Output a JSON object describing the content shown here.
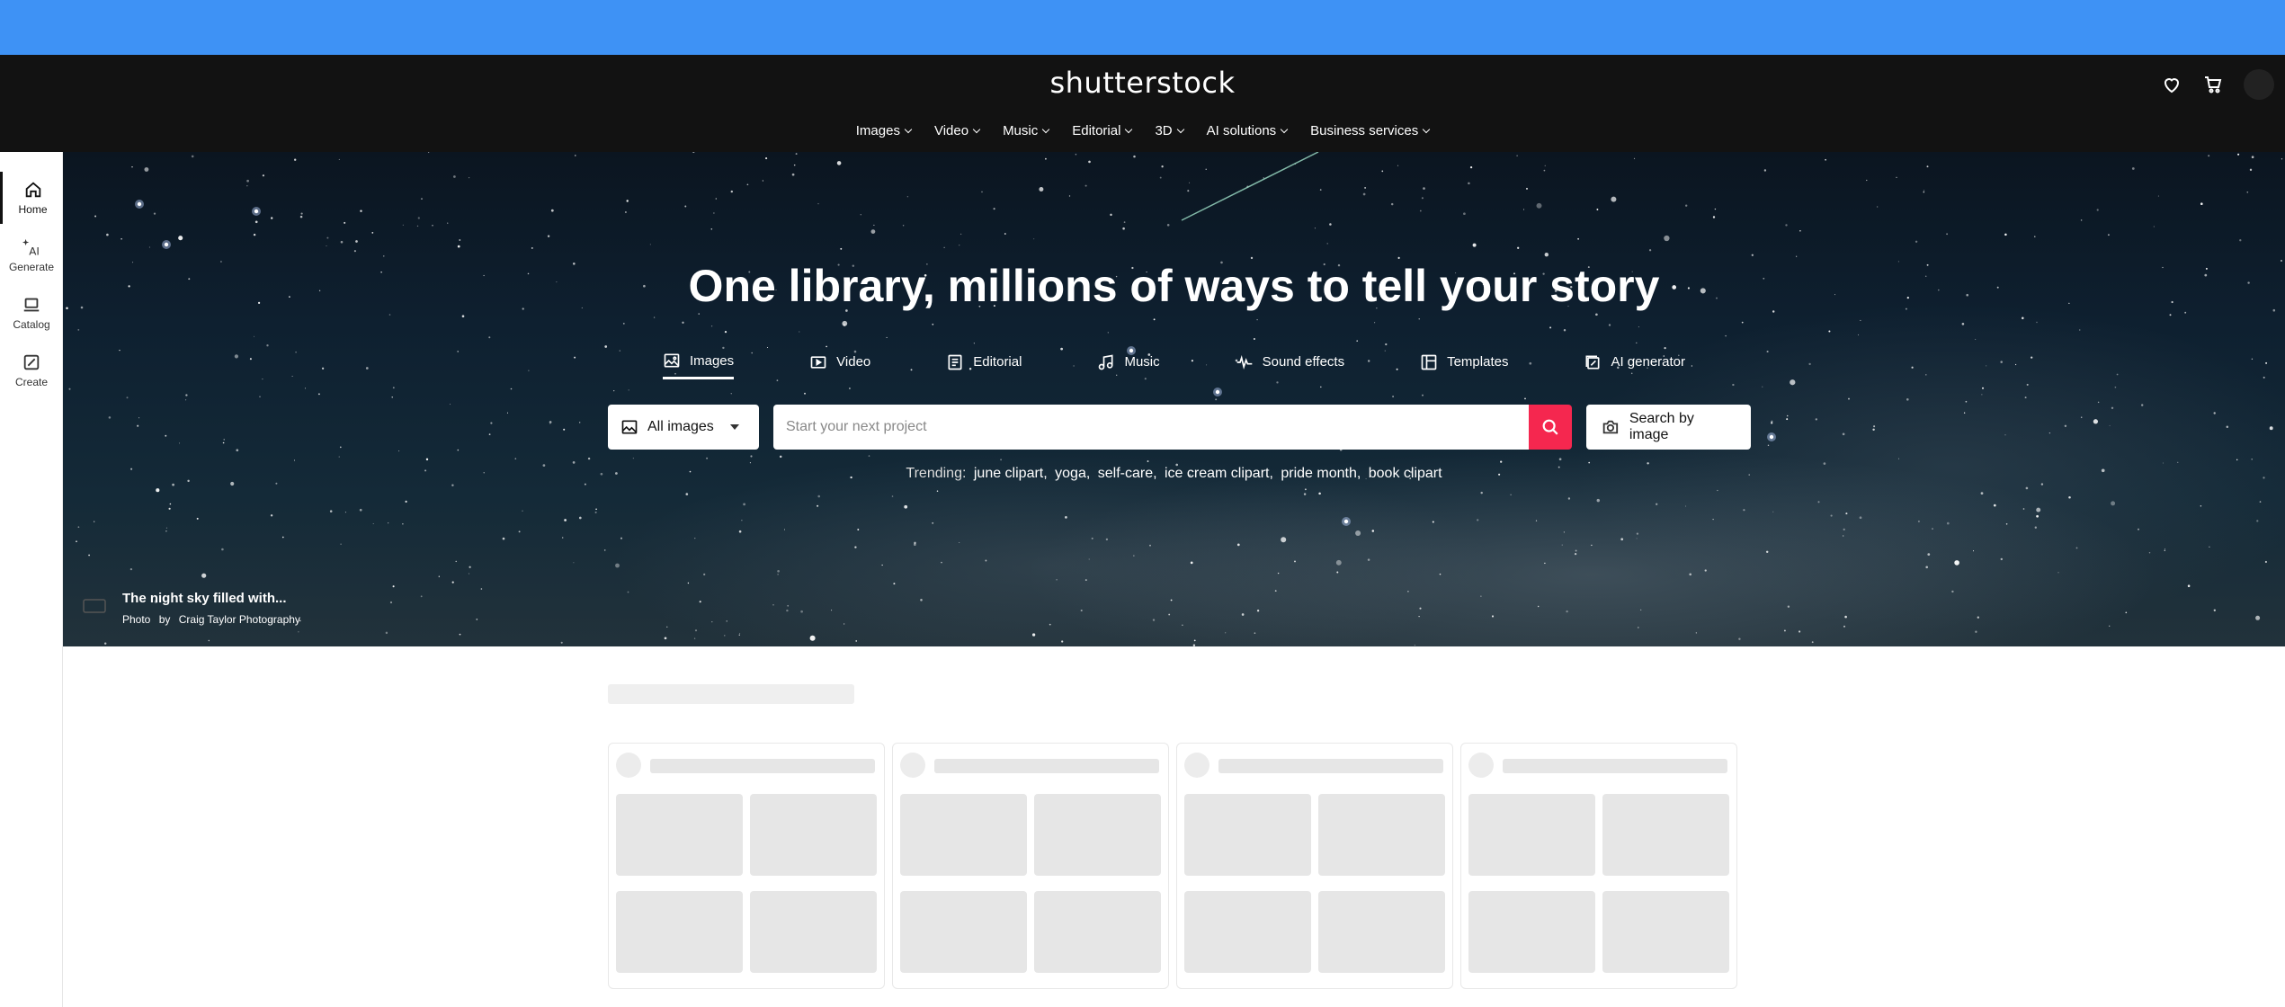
{
  "header": {
    "logo": "shutterstock",
    "nav": [
      {
        "label": "Images"
      },
      {
        "label": "Video"
      },
      {
        "label": "Music"
      },
      {
        "label": "Editorial"
      },
      {
        "label": "3D"
      },
      {
        "label": "AI solutions"
      },
      {
        "label": "Business services"
      }
    ],
    "icons": [
      "heart-icon",
      "cart-icon",
      "avatar"
    ]
  },
  "sidebar": {
    "items": [
      {
        "label": "Home",
        "icon": "home-icon",
        "active": true
      },
      {
        "label": "Generate",
        "icon": "ai-sparkle-icon"
      },
      {
        "label": "Catalog",
        "icon": "catalog-icon"
      },
      {
        "label": "Create",
        "icon": "create-icon"
      }
    ]
  },
  "hero": {
    "title": "One library, millions of ways to tell your story",
    "tabs": [
      {
        "label": "Images",
        "icon": "image-icon",
        "active": true
      },
      {
        "label": "Video",
        "icon": "video-icon"
      },
      {
        "label": "Editorial",
        "icon": "editorial-icon"
      },
      {
        "label": "Music",
        "icon": "music-icon"
      },
      {
        "label": "Sound effects",
        "icon": "waveform-icon"
      },
      {
        "label": "Templates",
        "icon": "templates-icon"
      },
      {
        "label": "AI generator",
        "icon": "ai-generator-icon"
      }
    ],
    "search": {
      "type_label": "All images",
      "placeholder": "Start your next project",
      "value": "",
      "image_search_label": "Search by image"
    },
    "trending": {
      "label": "Trending:",
      "items": [
        "june clipart,",
        "yoga,",
        "self-care,",
        "ice cream clipart,",
        "pride month,",
        "book clipart"
      ]
    },
    "credit": {
      "title": "The night sky filled with...",
      "type": "Photo",
      "by": "by",
      "author": "Craig Taylor Photography"
    }
  },
  "colors": {
    "top_bar": "#3e92f5",
    "header_bg": "#121212",
    "search_button": "#f5274f",
    "skeleton": "#e6e6e6"
  }
}
